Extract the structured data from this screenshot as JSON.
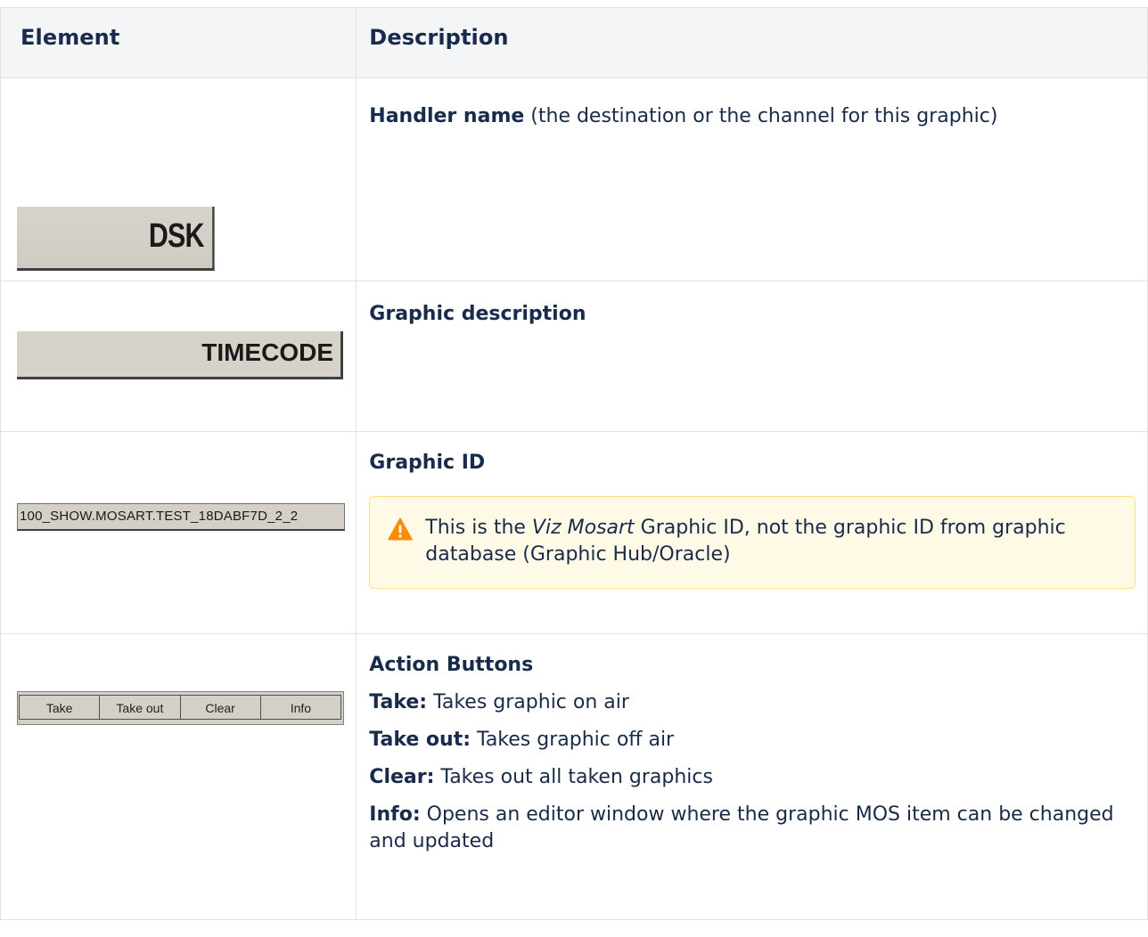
{
  "table": {
    "headers": {
      "element": "Element",
      "description": "Description"
    },
    "rows": [
      {
        "widget": {
          "text": "DSK"
        },
        "title": "Handler name",
        "subtitle": " (the destination or the channel for this graphic)"
      },
      {
        "widget": {
          "text": "TIMECODE"
        },
        "title": "Graphic description"
      },
      {
        "widget": {
          "text": "100_SHOW.MOSART.TEST_18DABF7D_2_2"
        },
        "title": "Graphic ID",
        "warning": {
          "icon": "warning-icon",
          "color": "#ff8b00",
          "before": "This is the ",
          "emphasis": "Viz Mosart",
          "after": " Graphic ID, not the graphic ID from graphic database (Graphic Hub/Oracle)"
        }
      },
      {
        "widget": {
          "buttons": [
            "Take",
            "Take out",
            "Clear",
            "Info"
          ]
        },
        "title": "Action Buttons",
        "items": [
          {
            "label": "Take:",
            "text": " Takes graphic on air"
          },
          {
            "label": "Take out:",
            "text": " Takes graphic off air"
          },
          {
            "label": "Clear:",
            "text": " Takes out all taken graphics"
          },
          {
            "label": "Info:",
            "text": " Opens an editor window where the graphic MOS item can be changed and updated"
          }
        ]
      }
    ]
  }
}
